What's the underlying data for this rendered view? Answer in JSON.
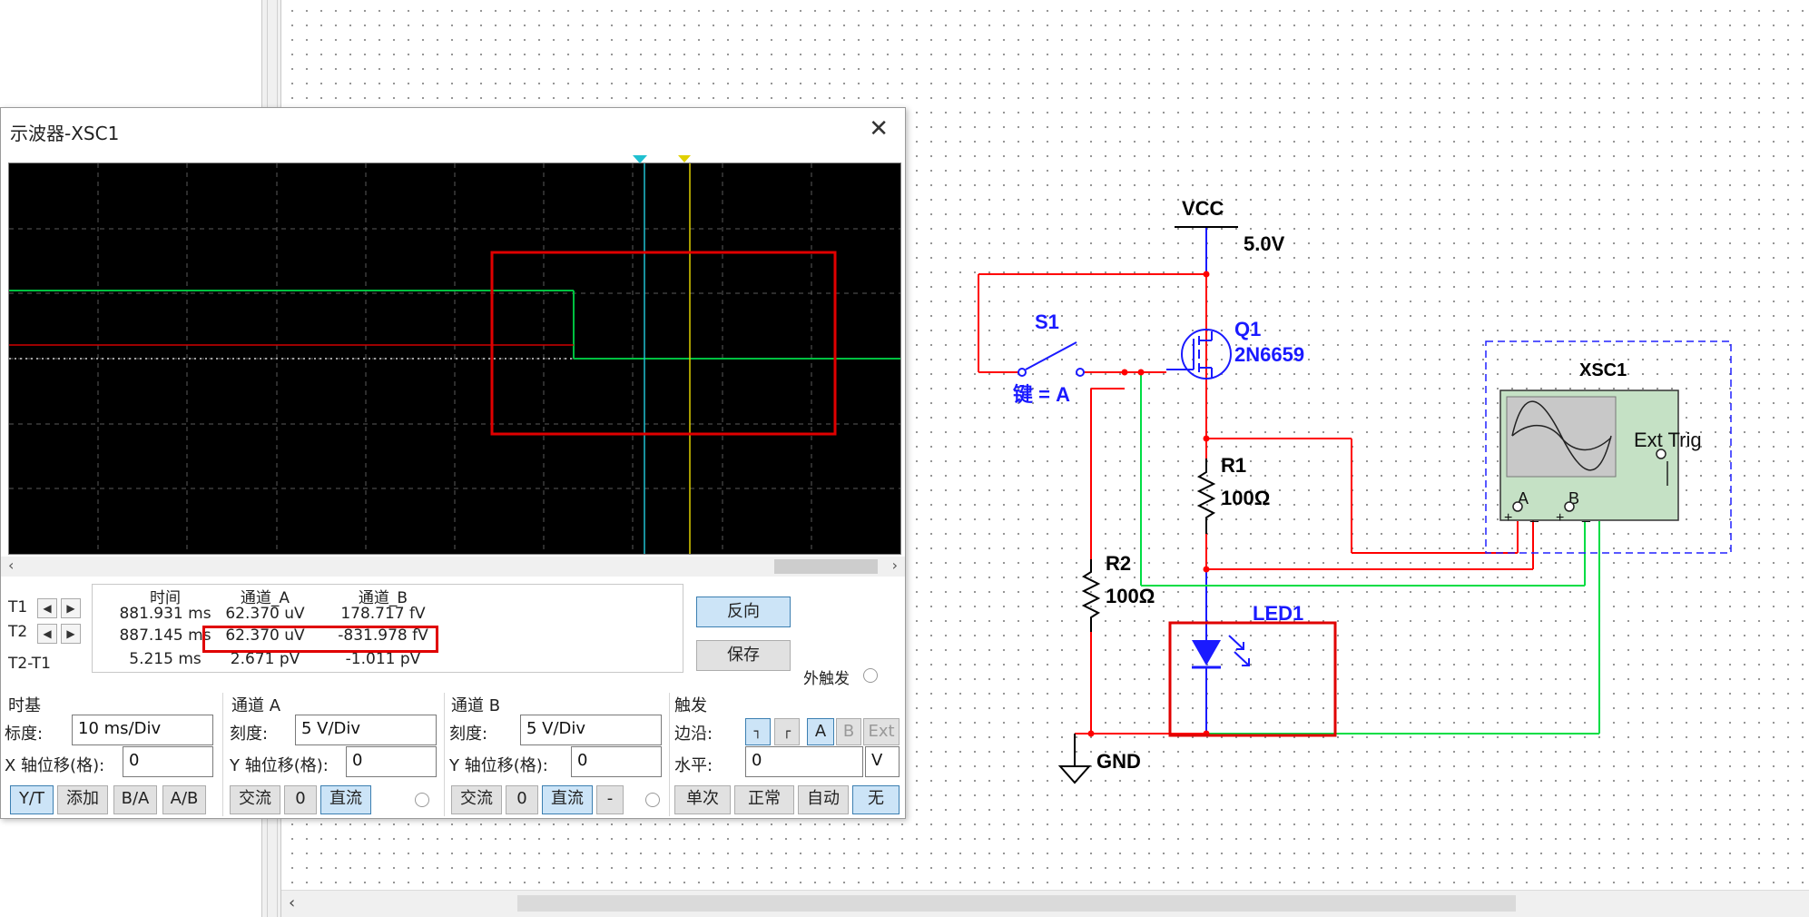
{
  "schematic": {
    "vcc_label": "VCC",
    "vcc_value": "5.0V",
    "switch_label": "S1",
    "switch_key": "键 = A",
    "q1_label": "Q1",
    "q1_part": "2N6659",
    "r1_label": "R1",
    "r1_value": "100Ω",
    "r2_label": "R2",
    "r2_value": "100Ω",
    "led_label": "LED1",
    "gnd_label": "GND",
    "scope_label": "XSC1",
    "ext_trig": "Ext Trig",
    "port_a": "A",
    "port_b": "B",
    "plus": "+",
    "minus": "_",
    "colors": {
      "wire_red": "#ff0000",
      "wire_green": "#00dd44",
      "part_blue": "#1a1aff",
      "highlight": "#e00000"
    }
  },
  "scope": {
    "title": "示波器-XSC1",
    "close_icon": "close-icon",
    "readout": {
      "headers": {
        "time": "时间",
        "ch_a": "通道_A",
        "ch_b": "通道_B"
      },
      "rows": [
        {
          "label": "T1",
          "time": "881.931 ms",
          "a": "62.370 uV",
          "b": "178.717 fV"
        },
        {
          "label": "T2",
          "time": "887.145 ms",
          "a": "62.370 uV",
          "b": "-831.978 fV"
        },
        {
          "label": "T2-T1",
          "time": "5.215 ms",
          "a": "2.671 pV",
          "b": "-1.011 pV"
        }
      ],
      "reverse": "反向",
      "save": "保存",
      "ext_trigger": "外触发"
    },
    "timebase": {
      "title": "时基",
      "scale_label": "标度:",
      "scale": "10 ms/Div",
      "xpos_label": "X 轴位移(格):",
      "xpos": "0",
      "buttons": [
        "Y/T",
        "添加",
        "B/A",
        "A/B"
      ]
    },
    "channel_a": {
      "title": "通道 A",
      "scale_label": "刻度:",
      "scale": "5  V/Div",
      "ypos_label": "Y 轴位移(格):",
      "ypos": "0",
      "buttons": [
        "交流",
        "0",
        "直流"
      ]
    },
    "channel_b": {
      "title": "通道 B",
      "scale_label": "刻度:",
      "scale": "5  V/Div",
      "ypos_label": "Y 轴位移(格):",
      "ypos": "0",
      "buttons": [
        "交流",
        "0",
        "直流",
        "-"
      ]
    },
    "trigger": {
      "title": "触发",
      "edge_label": "边沿:",
      "edge_sources": [
        "A",
        "B",
        "Ext"
      ],
      "level_label": "水平:",
      "level": "0",
      "level_unit": "V",
      "modes": [
        "单次",
        "正常",
        "自动",
        "无"
      ]
    }
  }
}
